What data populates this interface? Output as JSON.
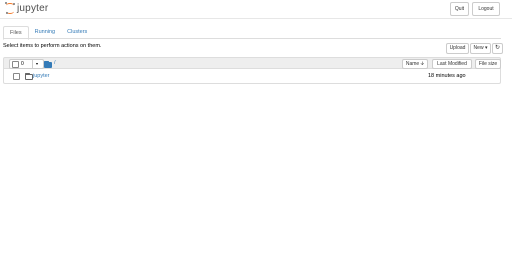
{
  "header": {
    "logo_text": "jupyter",
    "quit_label": "Quit",
    "logout_label": "Logout"
  },
  "tabs": [
    {
      "label": "Files",
      "active": true
    },
    {
      "label": "Running",
      "active": false
    },
    {
      "label": "Clusters",
      "active": false
    }
  ],
  "toolbar": {
    "hint": "Select items to perform actions on them.",
    "upload_label": "Upload",
    "new_label": "New ▾",
    "refresh_icon": "refresh-icon"
  },
  "list_header": {
    "selected_count": "0",
    "breadcrumb_root": "/",
    "sort_name_label": "Name 🡫",
    "last_modified_label": "Last Modified",
    "file_size_label": "File size"
  },
  "files": [
    {
      "name": "jupyter",
      "type": "folder",
      "modified": "18 minutes ago"
    }
  ],
  "colors": {
    "link": "#337ab7",
    "logo_orange": "#f37726"
  }
}
